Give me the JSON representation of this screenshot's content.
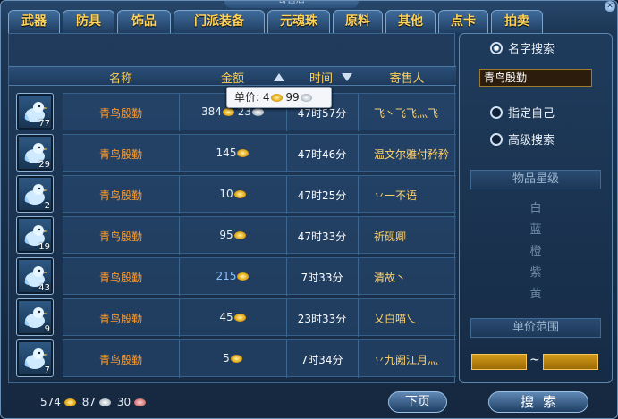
{
  "window": {
    "title": "寄售店"
  },
  "tabs": [
    "武器",
    "防具",
    "饰品",
    "门派装备",
    "元魂珠",
    "原料",
    "其他",
    "点卡",
    "拍卖"
  ],
  "columns": {
    "name": "名称",
    "price": "金额",
    "time": "时间",
    "seller": "寄售人"
  },
  "tooltip": {
    "label": "单价:",
    "gold": "4",
    "silver": "99"
  },
  "rows": [
    {
      "count": "77",
      "name": "青鸟殷勤",
      "price_gold": "384",
      "price_silver": "23",
      "time": "47时57分",
      "seller": "飞丶飞飞灬飞"
    },
    {
      "count": "29",
      "name": "青鸟殷勤",
      "price_gold": "145",
      "price_silver": "",
      "time": "47时46分",
      "seller": "温文尔雅付矜矜"
    },
    {
      "count": "2",
      "name": "青鸟殷勤",
      "price_gold": "10",
      "price_silver": "",
      "time": "47时25分",
      "seller": "丷一不语"
    },
    {
      "count": "19",
      "name": "青鸟殷勤",
      "price_gold": "95",
      "price_silver": "",
      "time": "47时33分",
      "seller": "祈砚卿"
    },
    {
      "count": "43",
      "name": "青鸟殷勤",
      "price_gold": "215",
      "price_silver": "",
      "time": "7时33分",
      "seller": "清故丶"
    },
    {
      "count": "9",
      "name": "青鸟殷勤",
      "price_gold": "45",
      "price_silver": "",
      "time": "23时33分",
      "seller": "乂白喵乀"
    },
    {
      "count": "7",
      "name": "青鸟殷勤",
      "price_gold": "5",
      "price_silver": "",
      "time": "7时34分",
      "seller": "丷九阙江月灬"
    }
  ],
  "wallet": {
    "gold": "574",
    "silver": "87",
    "copper": "30"
  },
  "buttons": {
    "next_page": "下页",
    "search": "搜索"
  },
  "search_panel": {
    "by_name": "名字搜索",
    "name_value": "青鸟殷勤",
    "by_self": "指定自己",
    "advanced": "高级搜索",
    "star_level_title": "物品星级",
    "star_levels": [
      "白",
      "蓝",
      "橙",
      "紫",
      "黄"
    ],
    "price_range_title": "单价范围",
    "range_separator": "~"
  },
  "colors": {
    "accent_gold": "#ffcf55",
    "item_name": "#ff9a2a",
    "seller": "#ffd36a",
    "panel_bg": "#1c3654"
  }
}
